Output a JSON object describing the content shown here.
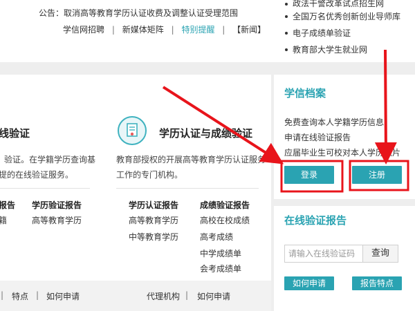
{
  "top": {
    "notice": "公告：取消高等教育学历认证收费及调整认证受理范围",
    "links": [
      "学信网招聘",
      "新媒体矩阵",
      "特别提醒",
      "【新闻】"
    ],
    "link_sep": "|",
    "right_list": [
      "政法干警改革试点招生网",
      "全国万名优秀创新创业导师库",
      "电子成绩单验证",
      "教育部大学生就业网"
    ]
  },
  "online_verify": {
    "title": "线验证",
    "desc_line1": "验证。在学籍学历查询基",
    "desc_line2": "提的在线验证服务。",
    "col1_head": "报告",
    "col1_items": [
      "籍"
    ],
    "col2_head": "学历验证报告",
    "col2_items": [
      "高等教育学历"
    ]
  },
  "cert": {
    "title": "学历认证与成绩验证",
    "desc_line1": "教育部授权的开展高等教育学历认证服务",
    "desc_line2": "工作的专门机构。",
    "col1_head": "学历认证报告",
    "col1_items": [
      "高等教育学历",
      "中等教育学历"
    ],
    "col2_head": "成绩验证报告",
    "col2_items": [
      "高校在校成绩",
      "高考成绩",
      "中学成绩单",
      "会考成绩单"
    ]
  },
  "bottom_bar": {
    "left_items": [
      "|",
      "特点",
      "|",
      "如何申请"
    ],
    "right_items": [
      "代理机构",
      "|",
      "如何申请"
    ]
  },
  "xuexin_archive": {
    "title": "学信档案",
    "items": [
      "免费查询本人学籍学历信息",
      "申请在线验证报告",
      "应届毕业生可校对本人学历照片"
    ],
    "login_label": "登录",
    "register_label": "注册"
  },
  "online_report": {
    "title": "在线验证报告",
    "input_placeholder": "请输入在线验证码",
    "query_label": "查询",
    "how_apply_label": "如何申请",
    "report_features_label": "报告特点"
  },
  "colors": {
    "teal": "#2aa3b2",
    "annotation_red": "#e8141b",
    "highlight_link": "#2aa3b2"
  },
  "icons": {
    "cert_icon": "certificate-icon"
  }
}
